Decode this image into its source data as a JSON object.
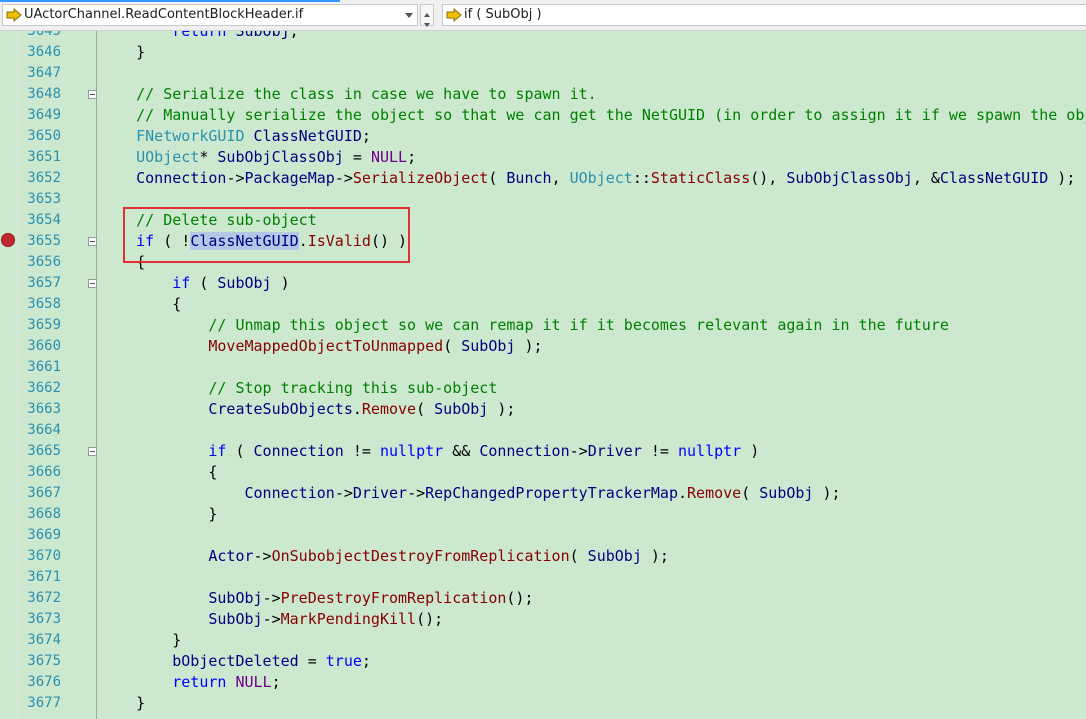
{
  "navbar": {
    "member_selector": "UActorChannel.ReadContentBlockHeader.if",
    "scope_selector": "if ( SubObj )"
  },
  "lines": [
    {
      "n": "3645",
      "t": "        return SubObj;"
    },
    {
      "n": "3646",
      "t": "    }"
    },
    {
      "n": "3647",
      "t": ""
    },
    {
      "n": "3648",
      "t": "    // Serialize the class in case we have to spawn it."
    },
    {
      "n": "3649",
      "t": "    // Manually serialize the object so that we can get the NetGUID (in order to assign it if we spawn the obj"
    },
    {
      "n": "3650",
      "t": "    FNetworkGUID ClassNetGUID;"
    },
    {
      "n": "3651",
      "t": "    UObject* SubObjClassObj = NULL;"
    },
    {
      "n": "3652",
      "t": "    Connection->PackageMap->SerializeObject( Bunch, UObject::StaticClass(), SubObjClassObj, &ClassNetGUID );"
    },
    {
      "n": "3653",
      "t": ""
    },
    {
      "n": "3654",
      "t": "    // Delete sub-object"
    },
    {
      "n": "3655",
      "t": "    if ( !ClassNetGUID.IsValid() )"
    },
    {
      "n": "3656",
      "t": "    {"
    },
    {
      "n": "3657",
      "t": "        if ( SubObj )"
    },
    {
      "n": "3658",
      "t": "        {"
    },
    {
      "n": "3659",
      "t": "            // Unmap this object so we can remap it if it becomes relevant again in the future"
    },
    {
      "n": "3660",
      "t": "            MoveMappedObjectToUnmapped( SubObj );"
    },
    {
      "n": "3661",
      "t": ""
    },
    {
      "n": "3662",
      "t": "            // Stop tracking this sub-object"
    },
    {
      "n": "3663",
      "t": "            CreateSubObjects.Remove( SubObj );"
    },
    {
      "n": "3664",
      "t": ""
    },
    {
      "n": "3665",
      "t": "            if ( Connection != nullptr && Connection->Driver != nullptr )"
    },
    {
      "n": "3666",
      "t": "            {"
    },
    {
      "n": "3667",
      "t": "                Connection->Driver->RepChangedPropertyTrackerMap.Remove( SubObj );"
    },
    {
      "n": "3668",
      "t": "            }"
    },
    {
      "n": "3669",
      "t": ""
    },
    {
      "n": "3670",
      "t": "            Actor->OnSubobjectDestroyFromReplication( SubObj );"
    },
    {
      "n": "3671",
      "t": ""
    },
    {
      "n": "3672",
      "t": "            SubObj->PreDestroyFromReplication();"
    },
    {
      "n": "3673",
      "t": "            SubObj->MarkPendingKill();"
    },
    {
      "n": "3674",
      "t": "        }"
    },
    {
      "n": "3675",
      "t": "        bObjectDeleted = true;"
    },
    {
      "n": "3676",
      "t": "        return NULL;"
    },
    {
      "n": "3677",
      "t": "    }"
    }
  ],
  "breakpoint_line": "3655",
  "colors": {
    "background": "#cce8cf",
    "keyword": "#0000ff",
    "comment": "#008000",
    "type": "#2b91af",
    "line_number": "#2b91af",
    "breakpoint": "#c0282e",
    "annotation_box": "#e03030"
  }
}
